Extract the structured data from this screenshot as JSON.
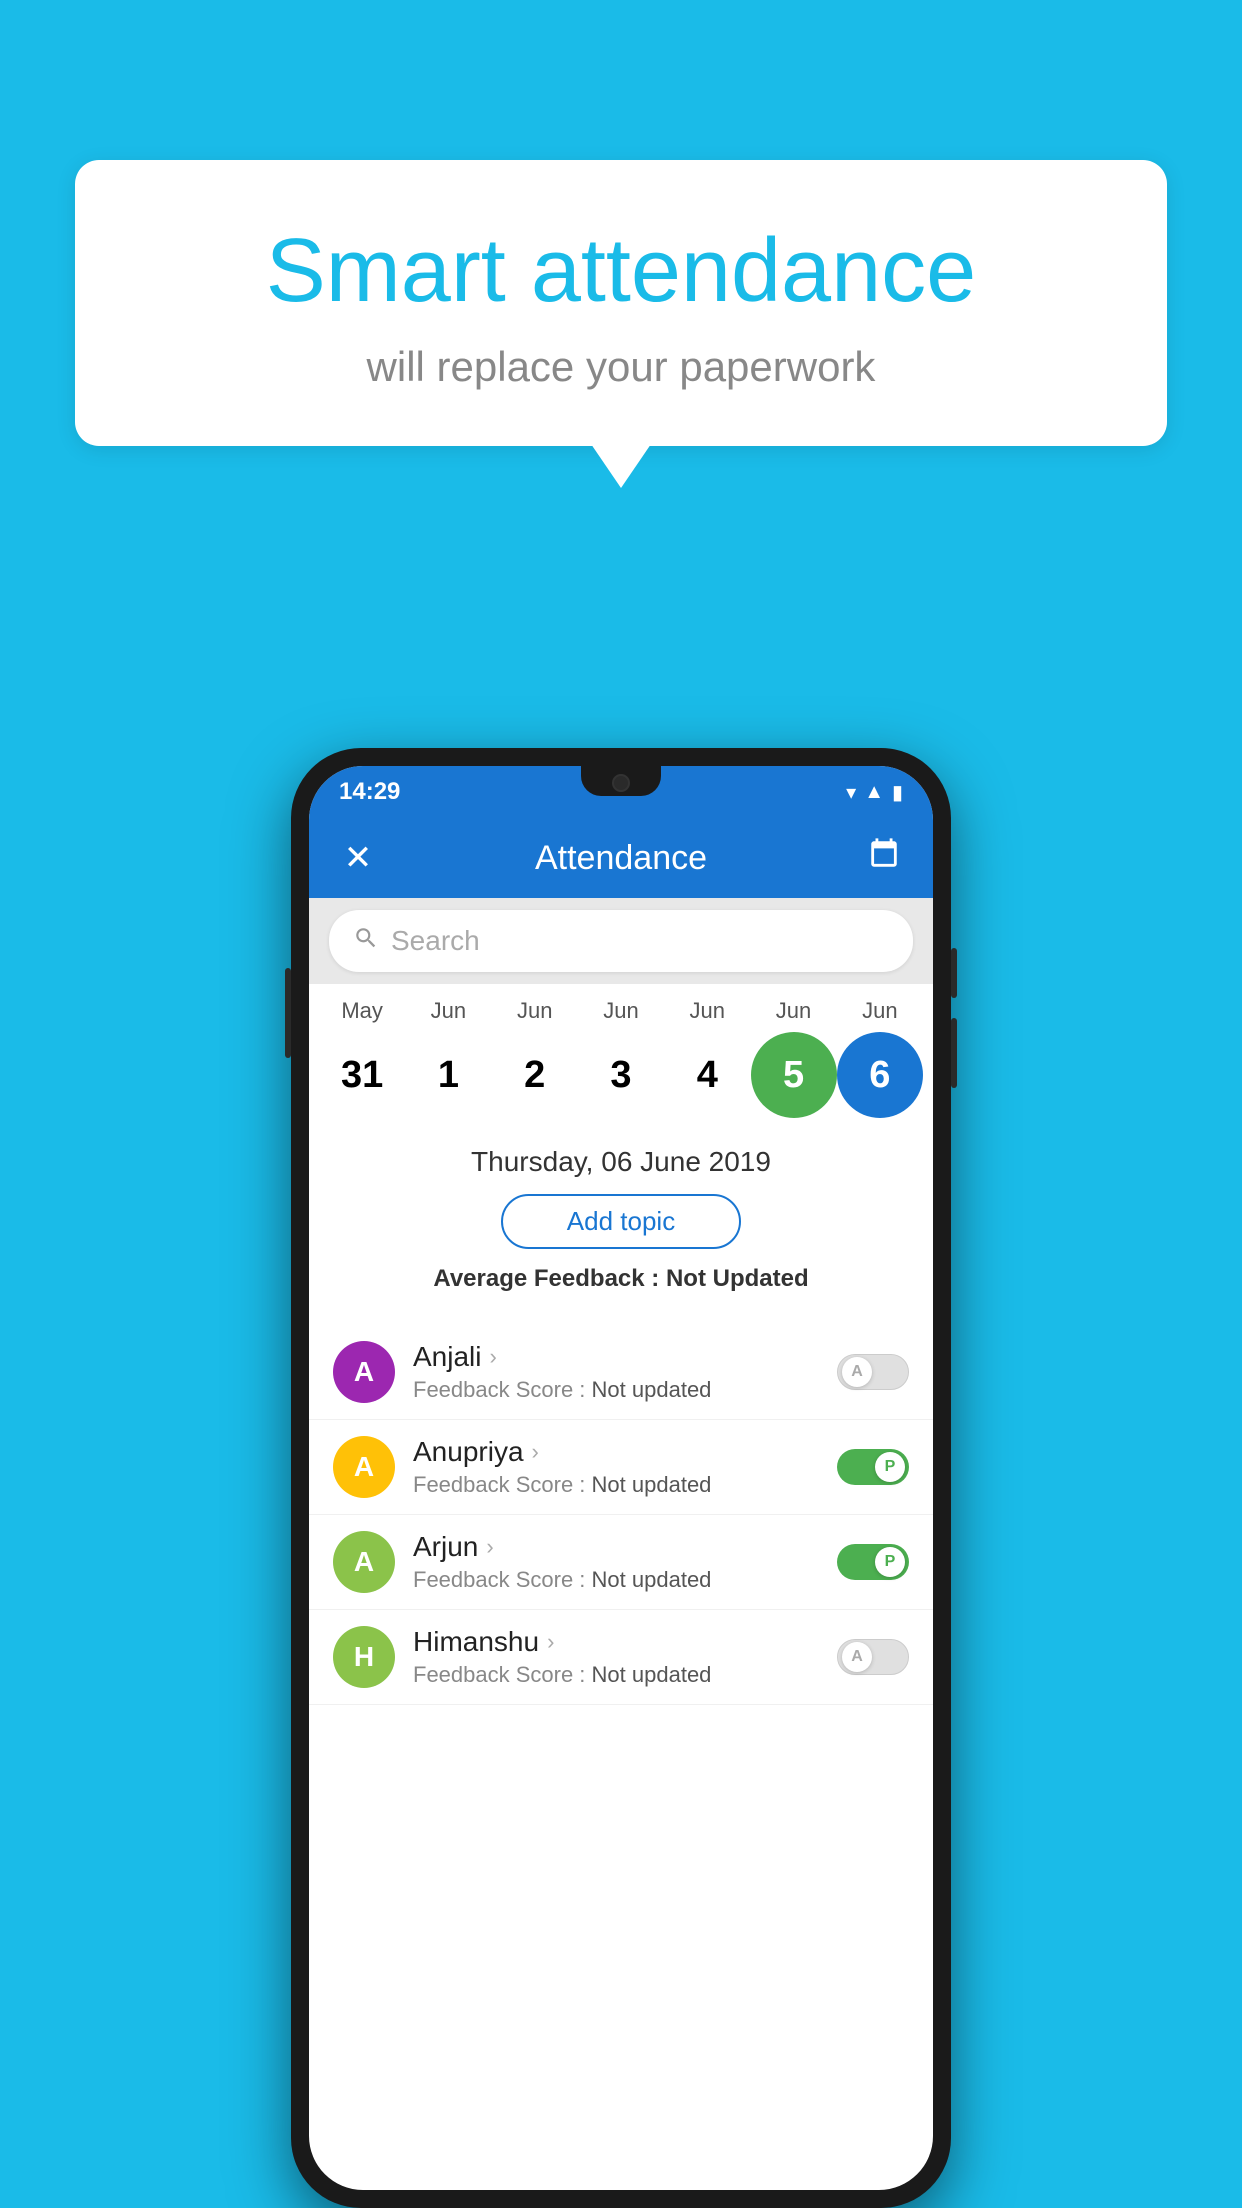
{
  "background_color": "#1ABBE8",
  "speech_bubble": {
    "title": "Smart attendance",
    "subtitle": "will replace your paperwork"
  },
  "status_bar": {
    "time": "14:29",
    "icons": [
      "wifi",
      "signal",
      "battery"
    ]
  },
  "app_bar": {
    "title": "Attendance",
    "back_icon": "✕",
    "calendar_icon": "📅"
  },
  "search": {
    "placeholder": "Search"
  },
  "calendar": {
    "months": [
      "May",
      "Jun",
      "Jun",
      "Jun",
      "Jun",
      "Jun",
      "Jun"
    ],
    "days": [
      {
        "day": "31",
        "state": "normal"
      },
      {
        "day": "1",
        "state": "normal"
      },
      {
        "day": "2",
        "state": "normal"
      },
      {
        "day": "3",
        "state": "normal"
      },
      {
        "day": "4",
        "state": "normal"
      },
      {
        "day": "5",
        "state": "today"
      },
      {
        "day": "6",
        "state": "selected"
      }
    ]
  },
  "selected_date": "Thursday, 06 June 2019",
  "add_topic_label": "Add topic",
  "avg_feedback_label": "Average Feedback :",
  "avg_feedback_value": "Not Updated",
  "students": [
    {
      "name": "Anjali",
      "avatar_letter": "A",
      "avatar_color": "#9C27B0",
      "feedback": "Feedback Score :",
      "feedback_value": "Not updated",
      "toggle": "off",
      "toggle_label": "A"
    },
    {
      "name": "Anupriya",
      "avatar_letter": "A",
      "avatar_color": "#FFC107",
      "feedback": "Feedback Score :",
      "feedback_value": "Not updated",
      "toggle": "on",
      "toggle_label": "P"
    },
    {
      "name": "Arjun",
      "avatar_letter": "A",
      "avatar_color": "#8BC34A",
      "feedback": "Feedback Score :",
      "feedback_value": "Not updated",
      "toggle": "on",
      "toggle_label": "P"
    },
    {
      "name": "Himanshu",
      "avatar_letter": "H",
      "avatar_color": "#8BC34A",
      "feedback": "Feedback Score :",
      "feedback_value": "Not updated",
      "toggle": "off",
      "toggle_label": "A"
    }
  ]
}
